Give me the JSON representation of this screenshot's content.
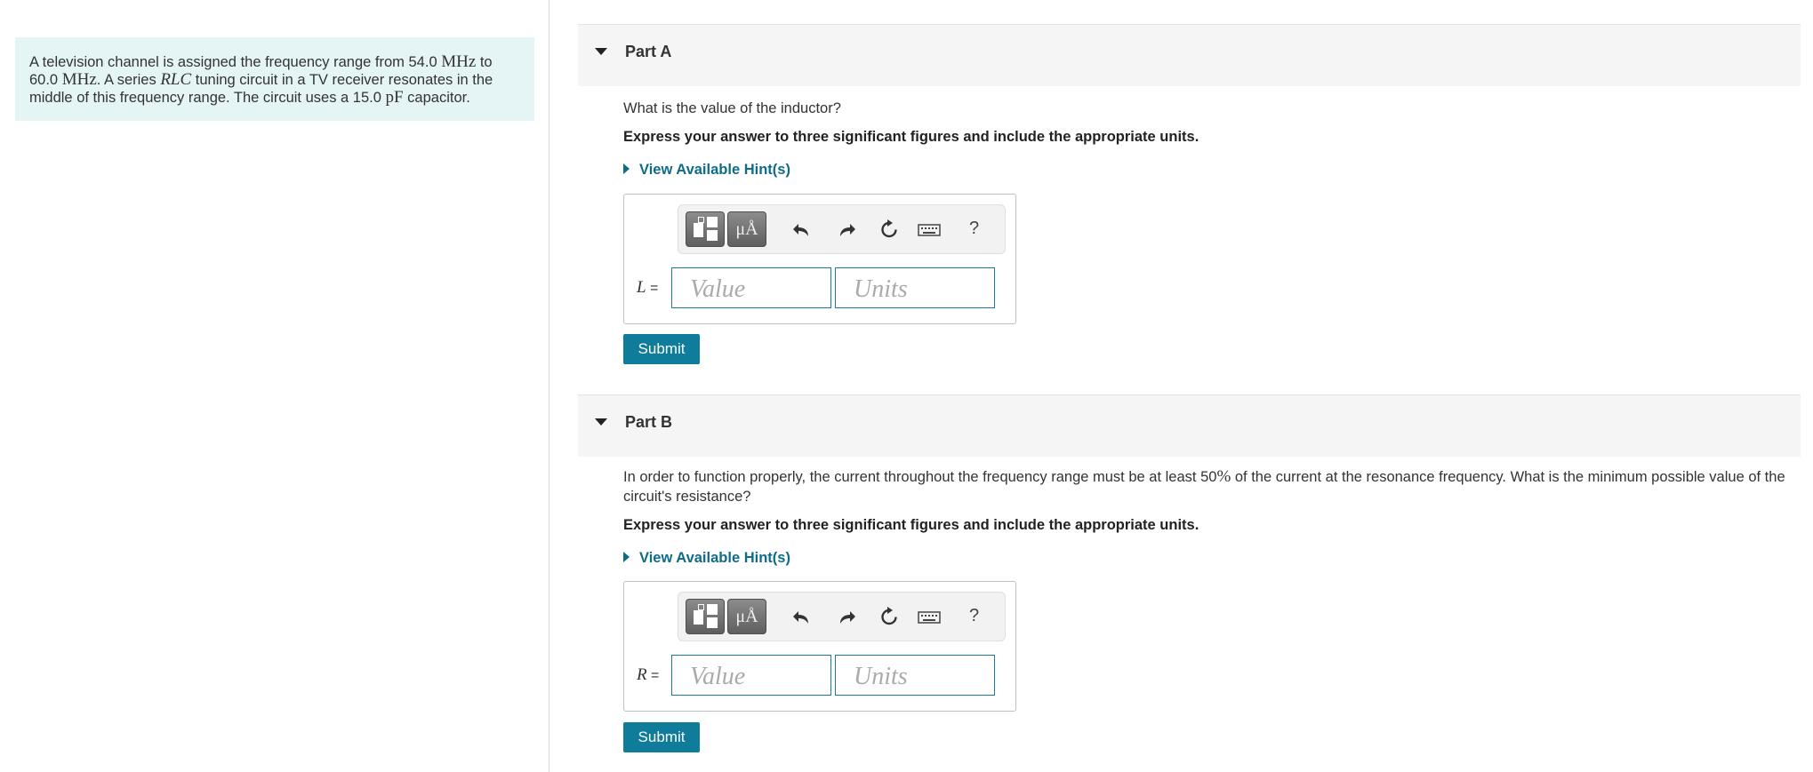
{
  "problem": {
    "text_1": "A television channel is assigned the frequency range from 54.0 ",
    "unit_mhz": "MHz",
    "text_2": " to",
    "value_60": "60.0 ",
    "text_3": ". A series ",
    "rlc": "RLC",
    "text_4": " tuning circuit in a TV receiver resonates in the",
    "text_5": "middle of this frequency range. The circuit uses a 15.0 ",
    "unit_pf": "pF",
    "text_6": " capacitor."
  },
  "parts": [
    {
      "title": "Part A",
      "question": "What is the value of the inductor?",
      "instruction": "Express your answer to three significant figures and include the appropriate units.",
      "hint_label": "View Available Hint(s)",
      "variable": "L",
      "equals": " =",
      "value_placeholder": "Value",
      "units_placeholder": "Units",
      "submit_label": "Submit"
    },
    {
      "title": "Part B",
      "question_1": "In order to function properly, the current throughout the frequency range must be at least 50",
      "question_pct": "%",
      "question_2": " of the current at the resonance frequency. What is the minimum possible value of the circuit's resistance?",
      "instruction": "Express your answer to three significant figures and include the appropriate units.",
      "hint_label": "View Available Hint(s)",
      "variable": "R",
      "equals": " =",
      "value_placeholder": "Value",
      "units_placeholder": "Units",
      "submit_label": "Submit"
    }
  ],
  "toolbar": {
    "unit_button_label": "μÅ",
    "help_label": "?",
    "icons": [
      "templates-icon",
      "units-icon",
      "undo-icon",
      "redo-icon",
      "reset-icon",
      "keyboard-icon",
      "help-icon"
    ]
  }
}
